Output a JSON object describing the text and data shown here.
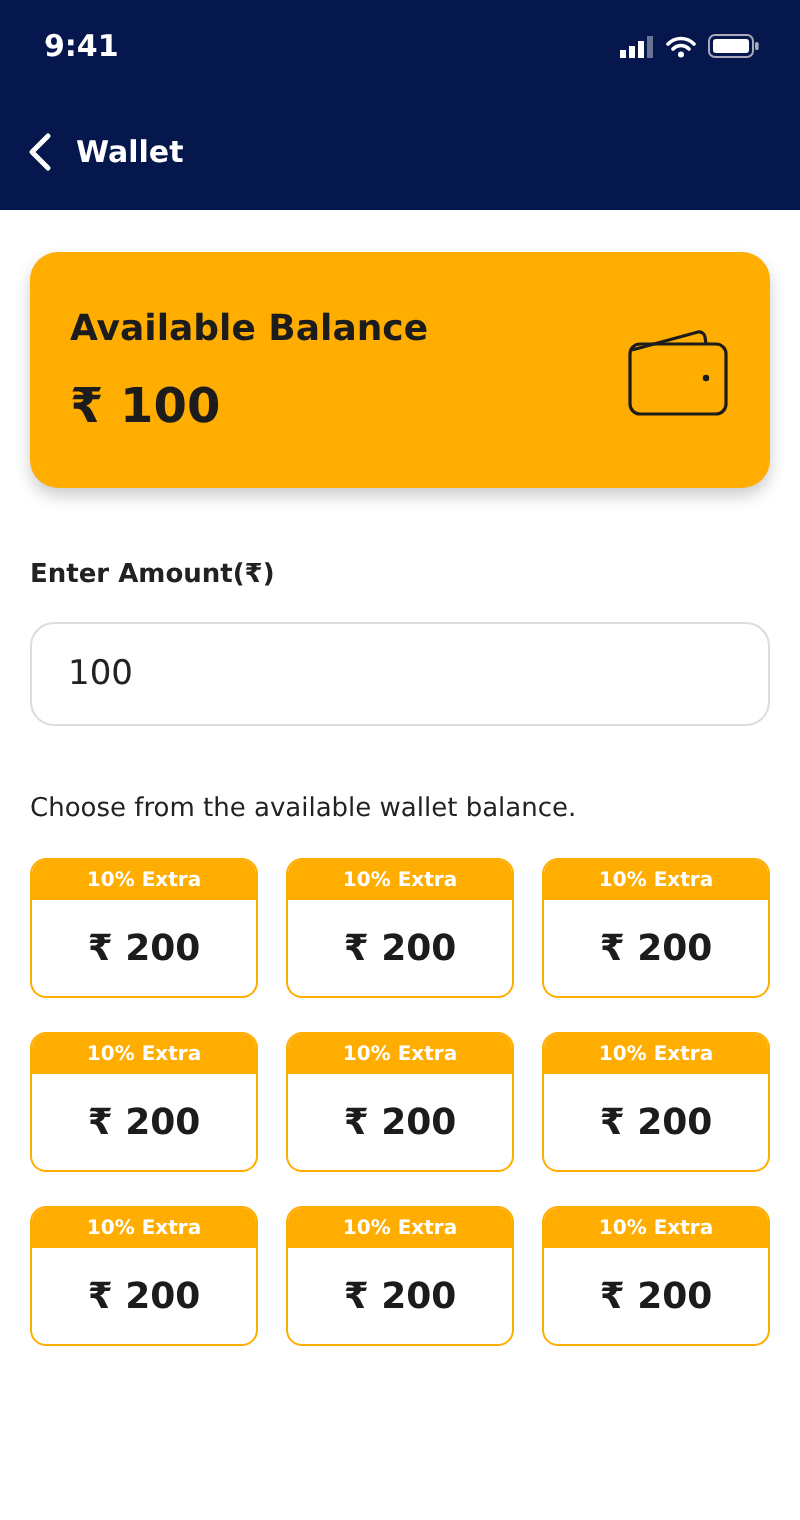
{
  "status_bar": {
    "time": "9:41"
  },
  "header": {
    "title": "Wallet"
  },
  "balance_card": {
    "title": "Available Balance",
    "amount": "₹ 100"
  },
  "amount_field": {
    "label": "Enter Amount(₹)",
    "value": "100"
  },
  "options_heading": "Choose from the available wallet balance.",
  "options": [
    {
      "badge": "10% Extra",
      "amount": "₹ 200"
    },
    {
      "badge": "10% Extra",
      "amount": "₹ 200"
    },
    {
      "badge": "10% Extra",
      "amount": "₹ 200"
    },
    {
      "badge": "10% Extra",
      "amount": "₹ 200"
    },
    {
      "badge": "10% Extra",
      "amount": "₹ 200"
    },
    {
      "badge": "10% Extra",
      "amount": "₹ 200"
    },
    {
      "badge": "10% Extra",
      "amount": "₹ 200"
    },
    {
      "badge": "10% Extra",
      "amount": "₹ 200"
    },
    {
      "badge": "10% Extra",
      "amount": "₹ 200"
    }
  ]
}
